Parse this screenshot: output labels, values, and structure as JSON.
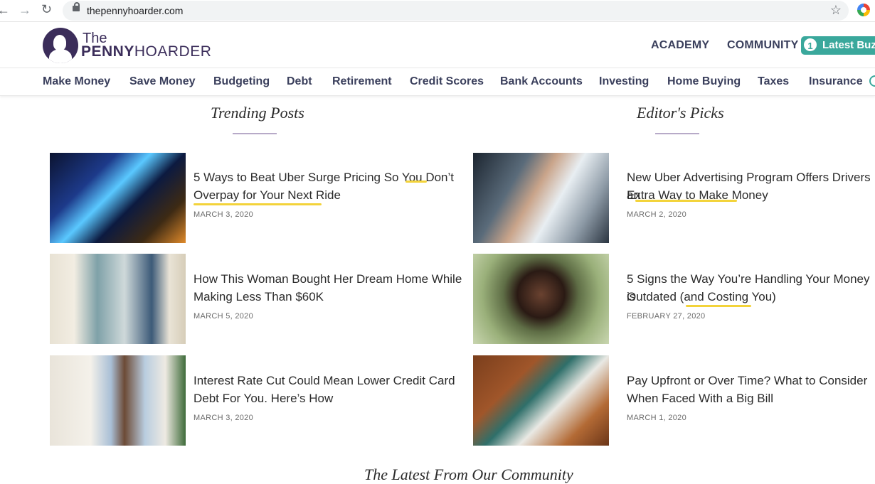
{
  "browser": {
    "url": "thepennyhoarder.com",
    "icons": [
      "back-arrow-icon",
      "forward-arrow-icon",
      "reload-icon",
      "lock-icon",
      "star-icon",
      "extension-icon"
    ]
  },
  "header": {
    "logo_the": "The",
    "logo_penny": "PENNY",
    "logo_hoarder": "HOARDER",
    "links": [
      "ACADEMY",
      "COMMUNITY"
    ],
    "buzz_count": "1",
    "buzz_label": "Latest Buzz"
  },
  "categories": [
    "Make Money",
    "Save Money",
    "Budgeting",
    "Debt",
    "Retirement",
    "Credit Scores",
    "Bank Accounts",
    "Investing",
    "Home Buying",
    "Taxes",
    "Insurance"
  ],
  "sections": {
    "trending": {
      "title": "Trending Posts",
      "articles": [
        {
          "title_l1": "5 Ways to Beat Uber Surge Pricing So You Don’t",
          "title_l2": "Overpay for Your Next Ride",
          "date": "MARCH 3, 2020"
        },
        {
          "title_l1": "How This Woman Bought Her Dream Home While",
          "title_l2": "Making Less Than $60K",
          "date": "MARCH 5, 2020"
        },
        {
          "title_l1": "Interest Rate Cut Could Mean Lower Credit Card",
          "title_l2": "Debt For You. Here’s How",
          "date": "MARCH 3, 2020"
        }
      ]
    },
    "editors": {
      "title": "Editor's Picks",
      "articles": [
        {
          "title_l1": "New Uber Advertising Program Offers Drivers an",
          "title_l2": "Extra Way to Make Money",
          "date": "MARCH 2, 2020"
        },
        {
          "title_l1": "5 Signs the Way You’re Handling Your Money is",
          "title_l2": "Outdated (and Costing You)",
          "date": "FEBRUARY 27, 2020"
        },
        {
          "title_l1": "Pay Upfront or Over Time? What to Consider",
          "title_l2": "When Faced With a Big Bill",
          "date": "MARCH 1, 2020"
        }
      ]
    }
  },
  "community_title": "The Latest From Our Community"
}
